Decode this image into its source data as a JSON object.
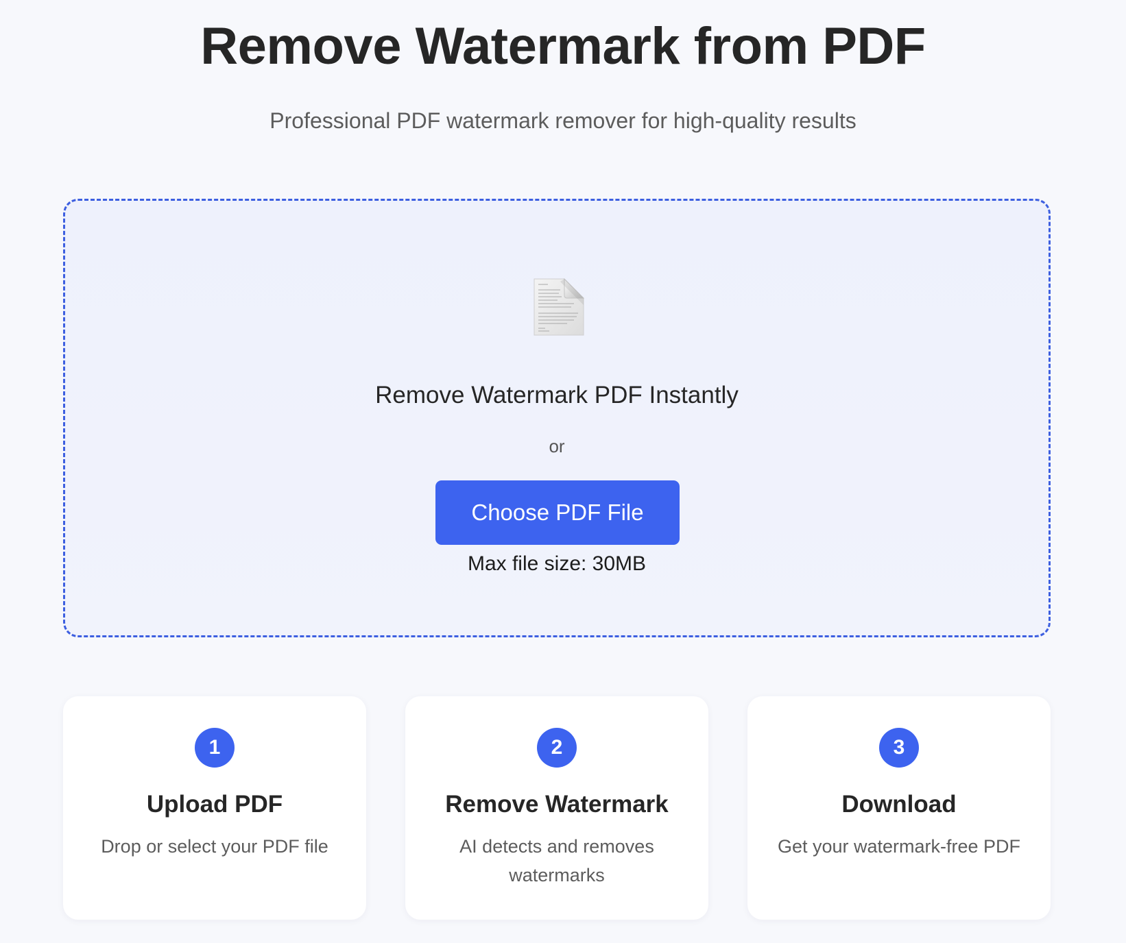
{
  "header": {
    "title": "Remove Watermark from PDF",
    "subtitle": "Professional PDF watermark remover for high-quality results"
  },
  "dropzone": {
    "icon": "document-icon",
    "heading": "Remove Watermark PDF Instantly",
    "or_text": "or",
    "button_label": "Choose PDF File",
    "max_size": "Max file size: 30MB"
  },
  "steps": [
    {
      "number": "1",
      "title": "Upload PDF",
      "description": "Drop or select your PDF file"
    },
    {
      "number": "2",
      "title": "Remove Watermark",
      "description": "AI detects and removes watermarks"
    },
    {
      "number": "3",
      "title": "Download",
      "description": "Get your watermark-free PDF"
    }
  ],
  "colors": {
    "accent": "#3d63ef",
    "dropzone_border": "#3d5fe0",
    "background": "#f7f8fc"
  }
}
